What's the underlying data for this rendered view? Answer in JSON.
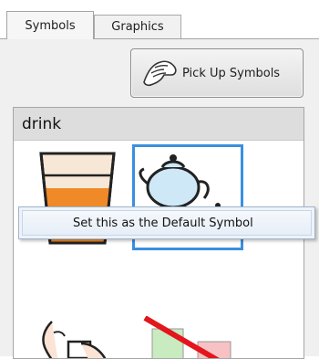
{
  "tabs": [
    {
      "label": "Symbols",
      "active": true
    },
    {
      "label": "Graphics",
      "active": false
    }
  ],
  "toolbar": {
    "pick_up_label": "Pick Up Symbols"
  },
  "symbols": {
    "search_word": "drink",
    "items": [
      {
        "icon": "glass-of-juice-icon",
        "selected": false
      },
      {
        "icon": "teapot-and-cup-icon",
        "selected": true
      },
      {
        "icon": "person-drinking-icon",
        "selected": false
      },
      {
        "icon": "crossed-out-squares-icon",
        "selected": false
      }
    ]
  },
  "context_menu": {
    "items": [
      {
        "label": "Set this as the Default Symbol"
      }
    ]
  },
  "colors": {
    "selection": "#3a8fe0",
    "header_bg": "#dddddd"
  }
}
